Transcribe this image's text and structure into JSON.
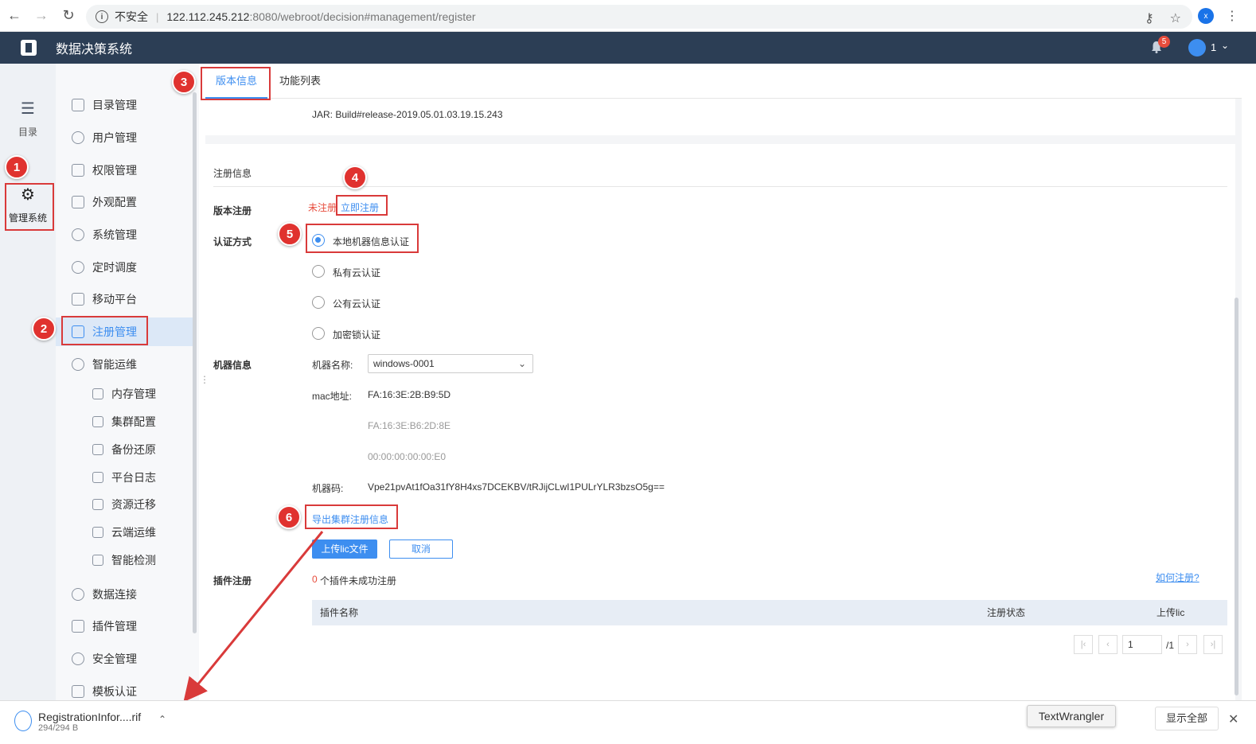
{
  "browser": {
    "security": "不安全",
    "url_host": "122.112.245.212",
    "url_rest": ":8080/webroot/decision#management/register",
    "ext_badge": "x"
  },
  "header": {
    "title": "数据决策系统",
    "notification_count": "5",
    "user": "1"
  },
  "rail": {
    "items": [
      {
        "label": "目录",
        "icon": "list-icon"
      },
      {
        "label": "管理系统",
        "icon": "gear-icon"
      }
    ]
  },
  "menu": {
    "items": [
      {
        "label": "目录管理"
      },
      {
        "label": "用户管理"
      },
      {
        "label": "权限管理"
      },
      {
        "label": "外观配置"
      },
      {
        "label": "系统管理"
      },
      {
        "label": "定时调度"
      },
      {
        "label": "移动平台"
      },
      {
        "label": "注册管理"
      },
      {
        "label": "智能运维"
      },
      {
        "label": "内存管理"
      },
      {
        "label": "集群配置"
      },
      {
        "label": "备份还原"
      },
      {
        "label": "平台日志"
      },
      {
        "label": "资源迁移"
      },
      {
        "label": "云端运维"
      },
      {
        "label": "智能检测"
      },
      {
        "label": "数据连接"
      },
      {
        "label": "插件管理"
      },
      {
        "label": "安全管理"
      },
      {
        "label": "模板认证"
      }
    ]
  },
  "tabs": [
    "版本信息",
    "功能列表"
  ],
  "jar": "JAR: Build#release-2019.05.01.03.19.15.243",
  "register": {
    "section_title": "注册信息",
    "version_label": "版本注册",
    "status": "未注册",
    "register_now": "立即注册",
    "auth_label": "认证方式",
    "auth_options": [
      "本地机器信息认证",
      "私有云认证",
      "公有云认证",
      "加密锁认证"
    ],
    "machine_label": "机器信息",
    "machine_name_label": "机器名称:",
    "machine_name": "windows-0001",
    "mac_label": "mac地址:",
    "macs": [
      "FA:16:3E:2B:B9:5D",
      "FA:16:3E:B6:2D:8E",
      "00:00:00:00:00:E0"
    ],
    "code_label": "机器码:",
    "code": "Vpe21pvAt1fOa31fY8H4xs7DCEKBV/tRJijCLwI1PULrYLR3bzsO5g==",
    "export_link": "导出集群注册信息",
    "upload_button": "上传lic文件",
    "cancel_button": "取消",
    "plugin_label": "插件注册",
    "plugin_count": "0",
    "plugin_text": "个插件未成功注册",
    "how_link": "如何注册?",
    "table_headers": [
      "插件名称",
      "注册状态",
      "上传lic"
    ],
    "page_value": "1",
    "page_total": "/1"
  },
  "annotations": [
    "1",
    "2",
    "3",
    "4",
    "5",
    "6"
  ],
  "download": {
    "file_name": "RegistrationInfor....rif",
    "file_size": "294/294 B",
    "tooltip": "TextWrangler",
    "show_all": "显示全部"
  },
  "colors": {
    "accent": "#3d8ef0",
    "header": "#2c3e55",
    "annotation": "#d93a3a"
  }
}
